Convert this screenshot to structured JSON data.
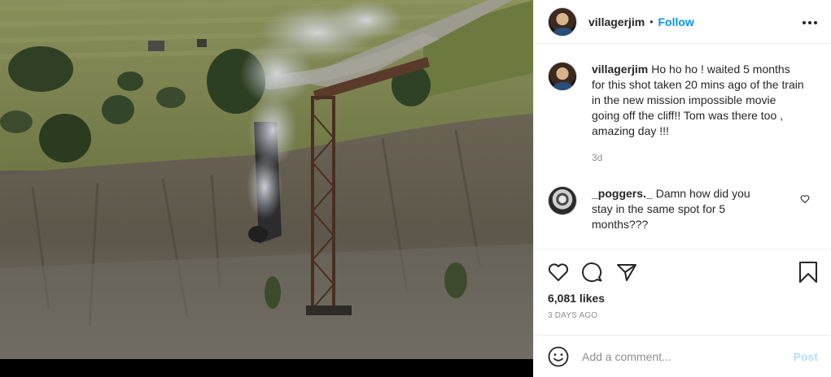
{
  "post": {
    "username": "villagerjim",
    "separator": "•",
    "follow_label": "Follow",
    "more_icon": "more-dots-icon",
    "caption": "Ho ho ho ! waited 5 months for this shot taken 20 mins ago of the train in the new mission impossible movie going off the cliff!! Tom was there too , amazing day !!!",
    "caption_time": "3d",
    "likes": "6,081 likes",
    "posted_ago": "3 DAYS AGO"
  },
  "comments": [
    {
      "username": "_poggers._",
      "text": "Damn how did you stay in the same spot for 5 months???"
    }
  ],
  "add_comment": {
    "placeholder": "Add a comment...",
    "post_label": "Post"
  },
  "colors": {
    "link_blue": "#0095f6",
    "post_disabled": "#b2dffc",
    "muted": "#8e8e8e",
    "text": "#262626"
  }
}
